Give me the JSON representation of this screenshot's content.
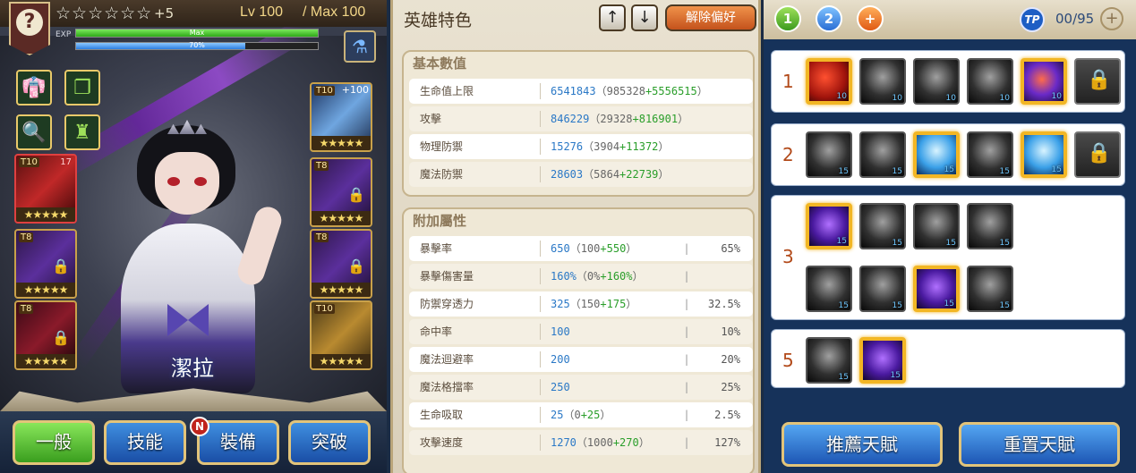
{
  "hero": {
    "stars": "☆☆☆☆☆☆",
    "stars_plus": "+5",
    "level": "Lv 100",
    "max_level": "/ Max 100",
    "exp_label": "EXP",
    "exp_text": "Max",
    "exp_progress": 1.0,
    "bar2_text": "70%",
    "bar2_progress": 0.7,
    "badge_glyph": "?",
    "name": "潔拉"
  },
  "equipment": [
    {
      "tier": "T10",
      "stars": "★★★★★",
      "plus": "+100"
    },
    {
      "tier": "T10",
      "stars": "★★★★★",
      "extra": "17"
    },
    {
      "tier": "T8",
      "stars": "★★★★★"
    },
    {
      "tier": "T8",
      "stars": "★★★★★"
    },
    {
      "tier": "T8",
      "stars": "★★★★★"
    },
    {
      "tier": "T8",
      "stars": "★★★★★"
    },
    {
      "tier": "T10",
      "stars": "★★★★★"
    }
  ],
  "bottom_tabs": {
    "general": "一般",
    "skills": "技能",
    "equipment": "裝備",
    "breakthrough": "突破",
    "badge": "N"
  },
  "middle": {
    "title": "英雄特色",
    "up": "↑",
    "down": "↓",
    "unfavorite": "解除偏好",
    "basic_title": "基本數值",
    "extra_title": "附加屬性",
    "basic": [
      {
        "label": "生命值上限",
        "value": "6541843",
        "base": "985328",
        "bonus": "+5556515"
      },
      {
        "label": "攻擊",
        "value": "846229",
        "base": "29328",
        "bonus": "+816901"
      },
      {
        "label": "物理防禦",
        "value": "15276",
        "base": "3904",
        "bonus": "+11372"
      },
      {
        "label": "魔法防禦",
        "value": "28603",
        "base": "5864",
        "bonus": "+22739"
      }
    ],
    "extra": [
      {
        "label": "暴擊率",
        "value": "650",
        "base": "100",
        "bonus": "+550",
        "pct": "65%"
      },
      {
        "label": "暴擊傷害量",
        "value": "160%",
        "base": "0%",
        "bonus": "+160%",
        "pct": ""
      },
      {
        "label": "防禦穿透力",
        "value": "325",
        "base": "150",
        "bonus": "+175",
        "pct": "32.5%"
      },
      {
        "label": "命中率",
        "value": "100",
        "base": "",
        "bonus": "",
        "pct": "10%"
      },
      {
        "label": "魔法迴避率",
        "value": "200",
        "base": "",
        "bonus": "",
        "pct": "20%"
      },
      {
        "label": "魔法格擋率",
        "value": "250",
        "base": "",
        "bonus": "",
        "pct": "25%"
      },
      {
        "label": "生命吸取",
        "value": "25",
        "base": "0",
        "bonus": "+25",
        "pct": "2.5%"
      },
      {
        "label": "攻擊速度",
        "value": "1270",
        "base": "1000",
        "bonus": "+270",
        "pct": "127%"
      }
    ]
  },
  "right": {
    "page1": "1",
    "page2": "2",
    "add": "+",
    "tp_label": "TP",
    "tp_count": "00/95",
    "tp_plus": "+",
    "tiers": [
      {
        "num": "1",
        "levels": [
          "10",
          "10",
          "10",
          "10",
          "10"
        ]
      },
      {
        "num": "2",
        "levels": [
          "15",
          "15",
          "15",
          "15",
          "15"
        ]
      },
      {
        "num": "3",
        "levels": [
          "15",
          "15",
          "15",
          "15",
          "15",
          "15",
          "15",
          "15"
        ]
      },
      {
        "num": "5",
        "levels": [
          "15",
          "15"
        ]
      }
    ],
    "recommend": "推薦天賦",
    "reset": "重置天賦"
  },
  "colors": {
    "accent_green": "#3a9e1e",
    "accent_blue": "#1d56b4",
    "bonus_green": "#2a9e2a",
    "value_blue": "#2a78c6",
    "selected_gold": "#f2b624"
  }
}
